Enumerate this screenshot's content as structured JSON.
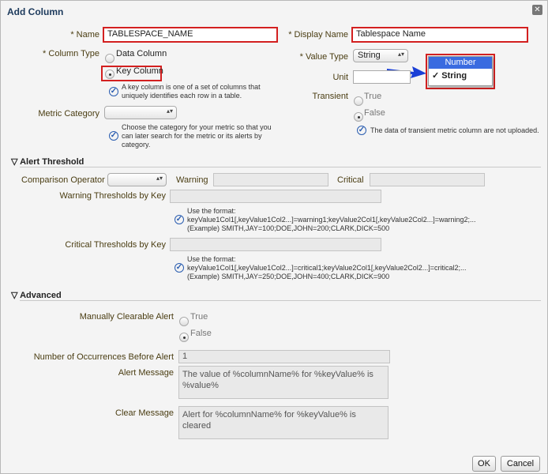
{
  "dialog": {
    "title": "Add Column",
    "close_icon": "close-icon"
  },
  "general": {
    "name_label": "* Name",
    "name_value": "TABLESPACE_NAME",
    "display_name_label": "* Display Name",
    "display_name_value": "Tablespace Name",
    "column_type_label": "* Column Type",
    "column_type_options": [
      "Data Column",
      "Key Column"
    ],
    "column_type_selected": "Key Column",
    "key_help": [
      "A key column is one of a set of columns that",
      "uniquely identifies each row in a table."
    ],
    "metric_category_label": "Metric Category",
    "metric_category_value": "",
    "metric_help": [
      "Choose the category for your metric so that you",
      "can later search for the metric or its alerts by",
      "category."
    ],
    "value_type_label": "* Value Type",
    "value_type_value": "String",
    "value_type_menu": [
      "Number",
      "String"
    ],
    "value_type_menu_highlight": "Number",
    "value_type_menu_checked": "String",
    "unit_label": "Unit",
    "unit_value": "",
    "transient_label": "Transient",
    "transient_options": [
      "True",
      "False"
    ],
    "transient_selected": "False",
    "transient_help": "The data of transient metric column are not uploaded."
  },
  "alert": {
    "section_title": "Alert Threshold",
    "comparison_label": "Comparison Operator",
    "warning_label": "Warning",
    "critical_label": "Critical",
    "warning_by_key_label": "Warning Thresholds by Key",
    "warning_help": [
      "Use the format:",
      "keyValue1Col1[,keyValue1Col2...]=warning1;keyValue2Col1[,keyValue2Col2...]=warning2;...",
      "(Example) SMITH,JAY=100;DOE,JOHN=200;CLARK,DICK=500"
    ],
    "critical_by_key_label": "Critical Thresholds by Key",
    "critical_help": [
      "Use the format:",
      "keyValue1Col1[,keyValue1Col2...]=critical1;keyValue2Col1[,keyValue2Col2...]=critical2;...",
      "(Example) SMITH,JAY=250;DOE,JOHN=400;CLARK,DICK=900"
    ]
  },
  "advanced": {
    "section_title": "Advanced",
    "clearable_label": "Manually Clearable Alert",
    "clearable_options": [
      "True",
      "False"
    ],
    "clearable_selected": "False",
    "occurrences_label": "Number of Occurrences Before Alert",
    "occurrences_value": "1",
    "alert_message_label": "Alert Message",
    "alert_message_value": "The value of %columnName% for %keyValue% is %value%",
    "clear_message_label": "Clear Message",
    "clear_message_value": "Alert for %columnName% for %keyValue% is cleared"
  },
  "buttons": {
    "ok": "OK",
    "cancel": "Cancel"
  },
  "colors": {
    "highlight": "#d32020",
    "arrow": "#1a3fd6",
    "menu_selected": "#3a6be0"
  }
}
